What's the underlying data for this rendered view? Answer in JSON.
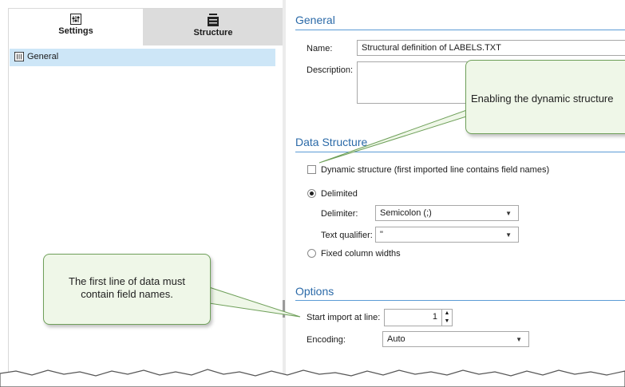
{
  "left_pane": {
    "tabs": [
      {
        "label": "Settings",
        "icon": "settings-icon",
        "active": true
      },
      {
        "label": "Structure",
        "icon": "structure-icon",
        "active": false
      }
    ],
    "tree_items": [
      {
        "label": "General",
        "icon": "settings-icon",
        "selected": true
      }
    ]
  },
  "general": {
    "title": "General",
    "name_label": "Name:",
    "name_value": "Structural definition of LABELS.TXT",
    "description_label": "Description:",
    "description_value": ""
  },
  "data_structure": {
    "title": "Data Structure",
    "dynamic_structure_label": "Dynamic structure (first imported line contains field names)",
    "dynamic_structure_checked": false,
    "delimited_label": "Delimited",
    "delimited_selected": true,
    "delimiter_label": "Delimiter:",
    "delimiter_value": "Semicolon (;)",
    "text_qualifier_label": "Text qualifier:",
    "text_qualifier_value": "\"",
    "fixed_widths_label": "Fixed column widths",
    "fixed_widths_selected": false
  },
  "options": {
    "title": "Options",
    "start_import_label": "Start import at line:",
    "start_import_value": "1",
    "encoding_label": "Encoding:",
    "encoding_value": "Auto"
  },
  "callouts": {
    "top_text": "Enabling the dynamic structure",
    "bottom_text": "The first line of data must contain field names."
  },
  "colors": {
    "accent": "#2b6aa8",
    "section_line": "#5b9bd5",
    "selection": "#cde6f7",
    "callout_bg": "#eff7e8",
    "callout_border": "#6fa05a"
  }
}
